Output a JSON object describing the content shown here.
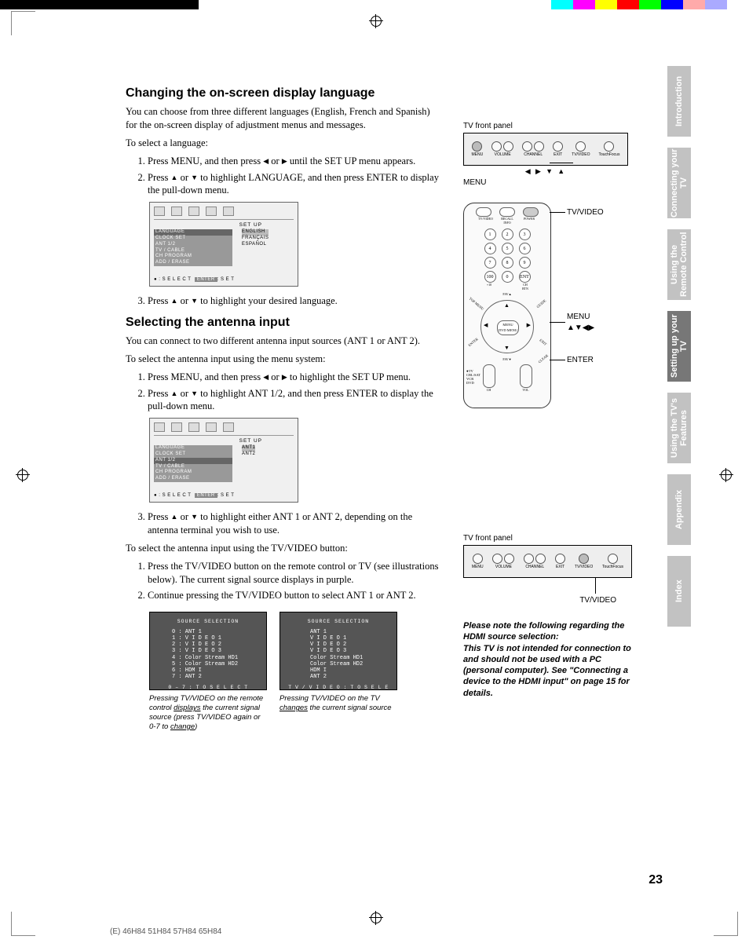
{
  "tabs": [
    "Introduction",
    "Connecting your TV",
    "Using the Remote Control",
    "Setting up your TV",
    "Using the TV's Features",
    "Appendix",
    "Index"
  ],
  "active_tab_index": 3,
  "h1": "Changing the on-screen display language",
  "p1": "You can choose from three different languages (English, French and Spanish) for the on-screen display of adjustment menus and messages.",
  "p2": "To select a language:",
  "s1_li1_a": "Press MENU, and then press ",
  "s1_li1_b": " or ",
  "s1_li1_c": " until the SET UP menu appears.",
  "s1_li2_a": "Press ",
  "s1_li2_b": " or ",
  "s1_li2_c": " to highlight LANGUAGE, and then press ENTER to display the pull-down menu.",
  "s1_li3_a": "Press ",
  "s1_li3_b": " or ",
  "s1_li3_c": " to highlight your desired language.",
  "menu1": {
    "title": "SET UP",
    "items": [
      "LANGUAGE",
      "CLOCK SET",
      "ANT 1/2",
      "TV / CABLE",
      "CH PROGRAM",
      "ADD / ERASE"
    ],
    "sel": 0,
    "opts": [
      "ENGLISH",
      "FRANÇAIS",
      "ESPAÑOL"
    ],
    "opt_sel": 0,
    "foot_a": "● : S E L E C T",
    "foot_b": "ENTER",
    "foot_c": ": S E T"
  },
  "h2": "Selecting the antenna input",
  "p3": "You can connect to two different antenna input sources (ANT 1 or ANT 2).",
  "p4": "To select the antenna input using the menu system:",
  "s2_li1_a": "Press MENU, and then press ",
  "s2_li1_b": " or ",
  "s2_li1_c": " to highlight the SET UP menu.",
  "s2_li2_a": "Press ",
  "s2_li2_b": " or ",
  "s2_li2_c": " to highlight ANT 1/2, and then press ENTER to display the pull-down menu.",
  "menu2": {
    "title": "SET UP",
    "items": [
      "LANGUAGE",
      "CLOCK SET",
      "ANT 1/2",
      "TV / CABLE",
      "CH PROGRAM",
      "ADD / ERASE"
    ],
    "sel": 2,
    "opts": [
      "ANT1",
      "ANT2"
    ],
    "opt_sel": 0,
    "foot_a": "● : S E L E C T",
    "foot_b": "ENTER",
    "foot_c": ": S E T"
  },
  "s2_li3_a": "Press ",
  "s2_li3_b": " or ",
  "s2_li3_c": " to highlight either ANT 1 or ANT 2, depending on the antenna terminal you wish to use.",
  "p5": "To select the antenna input using the TV/VIDEO button:",
  "s3_li1": "Press the TV/VIDEO button on the remote control or TV (see illustrations below). The current signal source displays in purple.",
  "s3_li2": "Continue pressing the TV/VIDEO button to select ANT 1 or ANT 2.",
  "src_title": "SOURCE  SELECTION",
  "src_a": [
    "0 : ANT 1",
    "1 : V I D E O  1",
    "2 : V I D E O  2",
    "3 : V I D E O  3",
    "4 : Color Stream  HD1",
    "5 : Color Stream  HD2",
    "6 : HDM I",
    "7 : ANT 2"
  ],
  "src_a_foot": "0 – 7 : T O  S E L E C T",
  "src_b": [
    "ANT 1",
    "V I D E O  1",
    "V I D E O  2",
    "V I D E O  3",
    "Color Stream  HD1",
    "Color Stream  HD2",
    "HDM I",
    "ANT 2"
  ],
  "src_b_foot": "T V / V I D E O : T O  S E L E C T",
  "cap_a_1": "Pressing TV/VIDEO on the remote control ",
  "cap_a_2": "displays",
  "cap_a_3": " the current signal source (press TV/VIDEO again or 0-7 to ",
  "cap_a_4": "change",
  "cap_a_5": ")",
  "cap_b_1": "Pressing TV/VIDEO on the TV ",
  "cap_b_2": "changes",
  "cap_b_3": " the current signal source",
  "panel_label": "TV front panel",
  "panel_btns": [
    "MENU",
    "VOLUME",
    "VOLUME",
    "CHANNEL",
    "CHANNEL",
    "EXIT",
    "TV/VIDEO",
    "TouchFocus"
  ],
  "panel_under1": "MENU",
  "panel_under2": "TV/VIDEO",
  "remote_labels": {
    "tvvideo": "TV/VIDEO",
    "menu": "MENU",
    "arrows": "▲▼◀▶",
    "enter": "ENTER"
  },
  "remote_top": [
    "TV/VIDEO",
    "RECALL",
    "POWER"
  ],
  "remote_info": "INFO",
  "remote_nums": [
    "1",
    "2",
    "3",
    "4",
    "5",
    "6",
    "7",
    "8",
    "9",
    "100",
    "0",
    "ENT"
  ],
  "remote_numlabels": [
    "+10",
    "",
    "CH RTN"
  ],
  "remote_fav": [
    "FAV▲",
    "FAV▼"
  ],
  "remote_center": [
    "MENU",
    "DVD MENU"
  ],
  "remote_side": [
    "ENTER",
    "EXIT"
  ],
  "remote_corners": [
    "TOP MENU",
    "GUIDE",
    "CLEAR"
  ],
  "remote_switch": [
    "TV",
    "CBL/SAT",
    "VCR",
    "DVD"
  ],
  "remote_bottom": [
    "CH",
    "VOL"
  ],
  "note1": "Please note the following regarding the HDMI source selection:",
  "note2": "This TV is not intended for connection to and should not be used with a PC (personal computer). See \"Connecting a device to the HDMI input\" on page 15 for details.",
  "pagenum": "23",
  "models": "(E) 46H84 51H84 57H84 65H84",
  "colorbar": [
    "#000",
    "#000",
    "#000",
    "#000",
    "#000",
    "#000",
    "#000",
    "#000",
    "#000",
    "#fff",
    "#fff",
    "#fff",
    "#fff",
    "#fff",
    "#fff",
    "#fff",
    "#fff",
    "#fff",
    "#fff",
    "#fff",
    "#fff",
    "#fff",
    "#fff",
    "#fff",
    "#fff",
    "#0ff",
    "#f0f",
    "#ff0",
    "#f00",
    "#0f0",
    "#00f",
    "#faa",
    "#aaf",
    "#fff"
  ]
}
